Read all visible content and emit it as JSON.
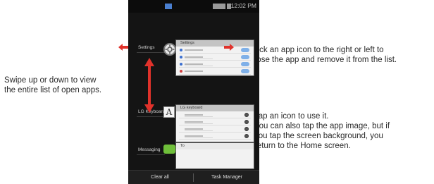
{
  "annotations": {
    "left": [
      "Swipe up or down to view",
      "the entire list of open apps."
    ],
    "right_top": [
      "Flick an app icon to the right or left to",
      "close the app and remove it from the list."
    ],
    "right_bottom": [
      "Tap an icon to use it.",
      "You can also tap the app image, but if",
      "you tap the screen background, you",
      "return to the Home screen."
    ]
  },
  "phone": {
    "status_time": "12:02 PM",
    "recent_apps": [
      {
        "label": "Settings",
        "icon": "gear-icon",
        "card_title": "Settings"
      },
      {
        "label": "LG Keyboard",
        "icon": "keyboard-letter-icon",
        "icon_glyph": "A",
        "card_title": "LG keyboard"
      },
      {
        "label": "Messaging",
        "icon": "message-bubble-icon",
        "card_title": "To"
      }
    ],
    "bottom_bar": {
      "clear_all": "Clear all",
      "task_manager": "Task Manager"
    }
  },
  "colors": {
    "arrow_red": "#e0322b",
    "screen_bg": "#141414"
  }
}
